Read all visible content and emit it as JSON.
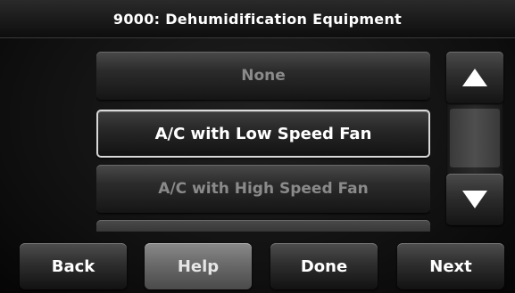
{
  "title": "9000: Dehumidification Equipment",
  "options": [
    {
      "label": "None",
      "selected": false
    },
    {
      "label": "A/C with Low Speed Fan",
      "selected": true
    },
    {
      "label": "A/C with High Speed Fan",
      "selected": false
    },
    {
      "label": "",
      "selected": false
    }
  ],
  "scroll": {
    "up_icon": "triangle-up-icon",
    "down_icon": "triangle-down-icon"
  },
  "nav": {
    "back_label": "Back",
    "help_label": "Help",
    "done_label": "Done",
    "next_label": "Next"
  },
  "colors": {
    "selected_border": "#d9d9d9",
    "text_active": "#ffffff",
    "text_inactive": "#8a8a8a",
    "help_button": "#6a6a6a"
  }
}
